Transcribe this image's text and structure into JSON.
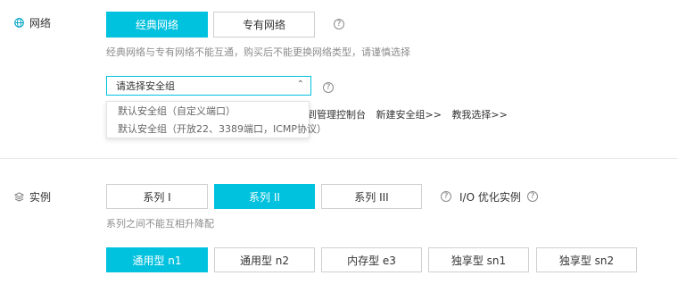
{
  "network": {
    "label": "网络",
    "options": [
      "经典网络",
      "专有网络"
    ],
    "selected_index": 0,
    "hint": "经典网络与专有网络不能互通，购买后不能更换网络类型，请谨慎选择",
    "help_glyph": "?",
    "security_group": {
      "placeholder": "请选择安全组",
      "dropdown_items": [
        "默认安全组（自定义端口）",
        "默认安全组（开放22、3389端口，ICMP协议）"
      ],
      "links_partial": "到管理控制台",
      "link_new": "新建安全组>>",
      "link_teach": "教我选择>>"
    }
  },
  "instance": {
    "label": "实例",
    "series": [
      "系列 I",
      "系列 II",
      "系列 III"
    ],
    "selected_series_index": 1,
    "io_optimized_label": "I/O 优化实例",
    "hint": "系列之间不能互相升降配",
    "types": [
      "通用型 n1",
      "通用型 n2",
      "内存型 e3",
      "独享型 sn1",
      "独享型 sn2"
    ],
    "selected_type_index": 0
  },
  "colors": {
    "accent": "#00c1de",
    "border": "#cfcfcf",
    "hint": "#8c8c8c"
  },
  "icons": {
    "network": "globe-icon",
    "instance": "layers-icon",
    "help": "question-circle-icon",
    "select": "chevron-up-icon"
  }
}
